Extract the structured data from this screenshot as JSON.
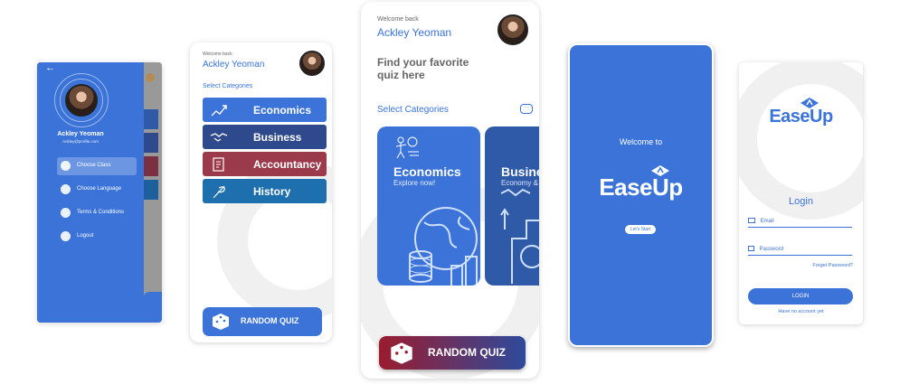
{
  "drawer": {
    "name": "Ackley Yeoman",
    "email": "Ackley@profile.com",
    "items": [
      {
        "label": "Choose Class",
        "icon": "class-icon"
      },
      {
        "label": "Choose Language",
        "icon": "language-icon"
      },
      {
        "label": "Terms & Conditions",
        "icon": "document-icon"
      },
      {
        "label": "Logout",
        "icon": "logout-icon"
      }
    ]
  },
  "home_list": {
    "welcome": "Welcome back",
    "name": "Ackley Yeoman",
    "section": "Select Categories",
    "categories": [
      {
        "label": "Economics",
        "color": "#3b73d9",
        "icon": "growth-icon"
      },
      {
        "label": "Business",
        "color": "#2e4a8c",
        "icon": "handshake-icon"
      },
      {
        "label": "Accountancy",
        "color": "#9b3a4a",
        "icon": "ledger-icon"
      },
      {
        "label": "History",
        "color": "#1e6fad",
        "icon": "quill-icon"
      }
    ],
    "random_quiz": "RANDOM QUIZ"
  },
  "home_cards": {
    "welcome": "Welcome back",
    "name": "Ackley Yeoman",
    "heading_line1": "Find your favorite",
    "heading_line2": "quiz here",
    "section": "Select Categories",
    "cards": [
      {
        "title": "Economics",
        "subtitle": "Explore now!",
        "color": "#3b73d9"
      },
      {
        "title": "Busine",
        "subtitle": "Economy &",
        "color": "#2e5aa8"
      }
    ],
    "random_quiz": "RANDOM QUIZ"
  },
  "splash": {
    "welcome": "Welcome to",
    "logo": "EaseUp",
    "button": "Let's Start",
    "bg": "#3b73d9"
  },
  "login": {
    "logo": "EaseUp",
    "title": "Login",
    "email_placeholder": "Email",
    "password_placeholder": "Password",
    "forgot": "Forget Password?",
    "button": "LOGIN",
    "signup": "Have no account yet"
  }
}
